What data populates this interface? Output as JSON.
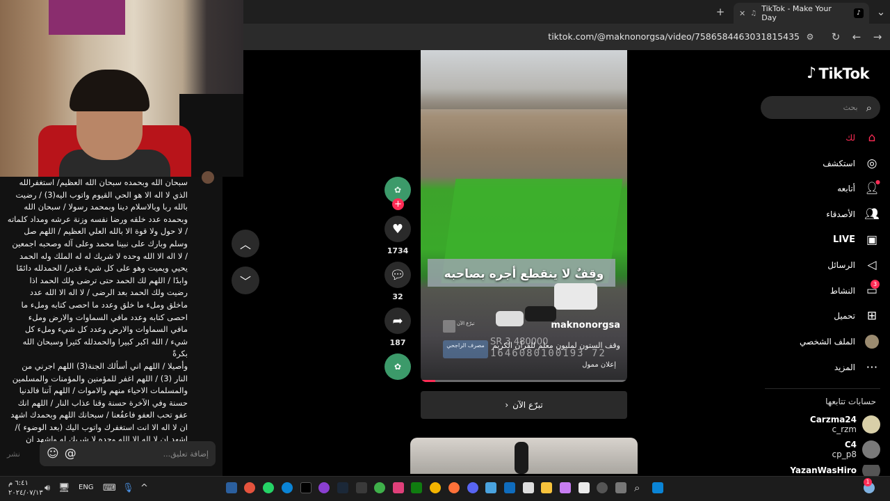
{
  "browser": {
    "tab_title": "TikTok - Make Your Day",
    "url": "tiktok.com/@maknonorgsa/video/7586584463031815435"
  },
  "comment": {
    "text": "سبحان الله وبحمده سبحان الله العظيم/ استغفرالله\nالذي لا اله الا هو الحي القيوم واتوب اليه(3) / رضيت\nبالله ربا وبالاسلام دينا وبمحمد رسولا / سبحان الله\nوبحمده عدد خلقه ورضا نفسه وزنة عرشه ومداد كلماته\n/ لا حول ولا قوة الا بالله العلي العظيم / اللهم صل\nوسلم وبارك على نبينا محمد وعلى آله وصحبه اجمعين\n/ لا اله الا الله وحده لا شريك له له الملك وله الحمد\nيحيي ويميت وهو على كل شيء قدير/ الحمدلله دائمًا\nوابدًا / اللهم لك الحمد حتى ترضى ولك الحمد اذا\nرضيت ولك الحمد بعد الرضى / لا اله الا الله عدد\nماخلق وملء ما خلق وعدد ما احصى كتابه وملء ما\nاحصى كتابه وعدد مافي السماوات والارض وملء\nمافي السماوات والارض وعدد كل شيء وملء كل\nشيء / الله اكبر كبيرا والحمدلله كثيرا وسبحان الله بكرةً\nوأصيلا / اللهم اني أسألك الجنة(3) اللهم اجرني من\nالنار (3) / اللهم اغفر للمؤمنين والمؤمنات والمسلمين\nوالمسلمات الاحياء منهم والاموات / اللهم آتنا فالدنيا\nحسنة وفي الآخرة حسنة وقنا عذاب النار / اللهم انك\nعفو تحب العفو فاعفُعنا / سبحانك اللهم وبحمدك اشهد\nان لا اله الا انت استغفرك واتوب اليك (بعد الوضوء )/\nاشهد ان لا اله الا الله وحده لا شريك له واشهد ان",
    "input_placeholder": "إضافة تعليق...",
    "post_label": "نشر"
  },
  "video": {
    "caption_overlay": "وقفٌ لا ينقطع أجره بصاحبه",
    "username": "maknonorgsa",
    "description": "وقف الستون لمليون معلم للقرآن الكريم",
    "amount": "SR 3 480000",
    "account_number": "1646080100193 72",
    "bank_name": "مصرف الراجحي",
    "wqf_logo_text": "تبرّع الآن",
    "sponsored": "إعلان ممول",
    "cta": "تبرّع الآن",
    "progress": 0.07
  },
  "actions": {
    "likes": "1734",
    "comments": "32",
    "shares": "187"
  },
  "sidebar": {
    "logo": "TikTok",
    "search_placeholder": "بحث",
    "nav": [
      {
        "label": "لك",
        "icon": "home-icon",
        "active": true
      },
      {
        "label": "استكشف",
        "icon": "compass-icon"
      },
      {
        "label": "أتابعه",
        "icon": "following-icon"
      },
      {
        "label": "الأصدقاء",
        "icon": "friends-icon"
      },
      {
        "label": "LIVE",
        "icon": "live-icon"
      },
      {
        "label": "الرسائل",
        "icon": "messages-icon"
      },
      {
        "label": "النشاط",
        "icon": "activity-icon",
        "badge": "3"
      },
      {
        "label": "تحميل",
        "icon": "upload-icon"
      },
      {
        "label": "الملف الشخصي",
        "icon": "avatar-icon"
      },
      {
        "label": "المزيد",
        "icon": "more-icon"
      }
    ],
    "following_title": "حسابات تتابعها",
    "following": [
      {
        "username": "Carzma24",
        "handle": "c_rzm"
      },
      {
        "username": "C4",
        "handle": "cp_p8"
      },
      {
        "username": "YazanWasHiro",
        "handle": ""
      }
    ]
  },
  "taskbar": {
    "time": "٦:٤١ م",
    "date": "٢٠٢٤/٠٧/١٣",
    "lang": "ENG",
    "notification_count": "1"
  },
  "colors": {
    "accent": "#fe2c55",
    "panel": "#121212",
    "button": "#2a2a2a"
  }
}
